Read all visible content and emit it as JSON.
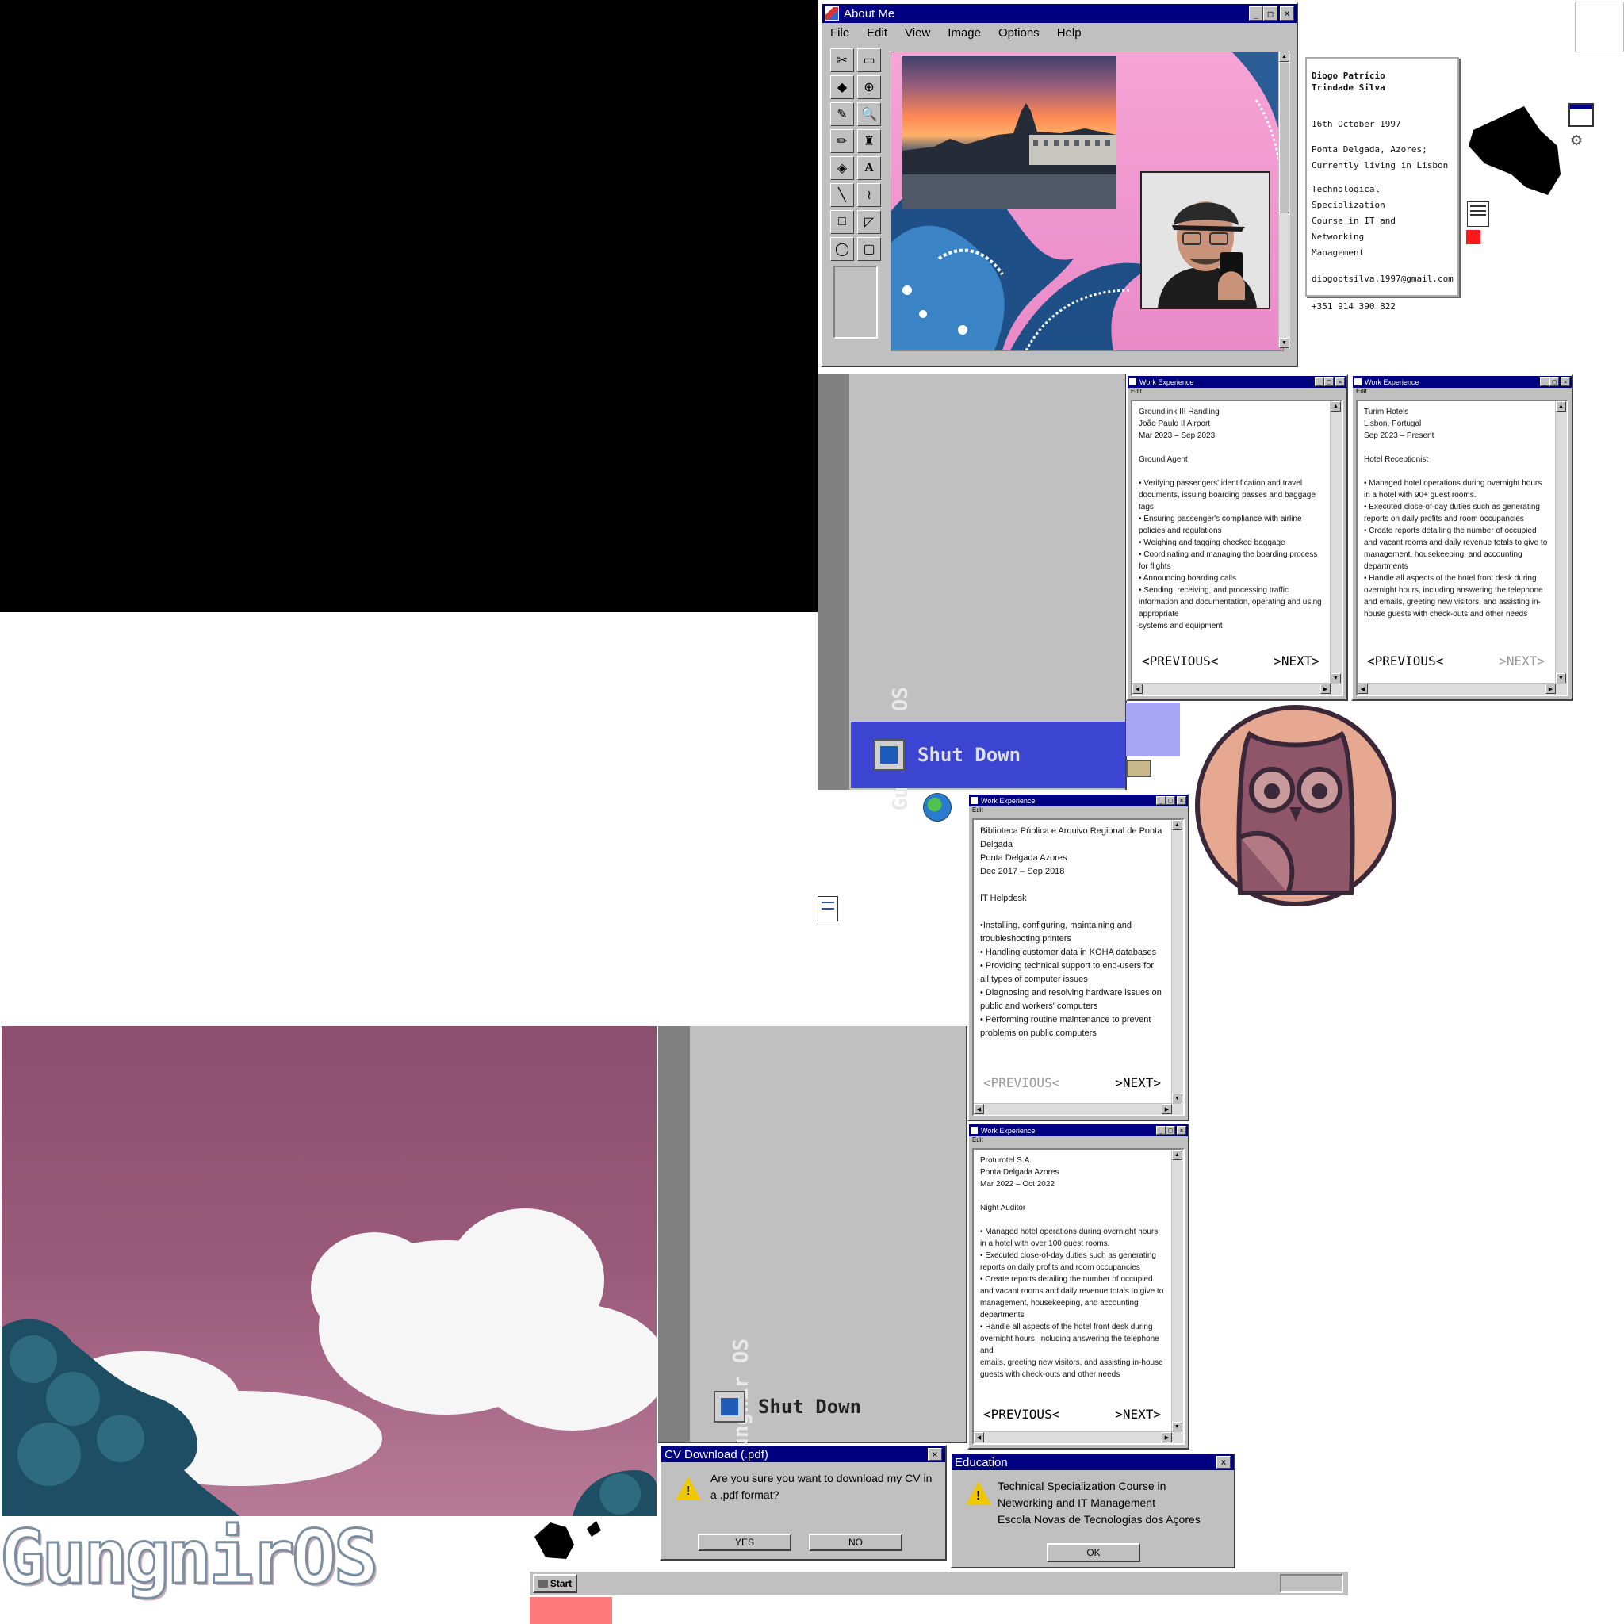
{
  "about": {
    "title": "About Me",
    "menu": [
      "File",
      "Edit",
      "View",
      "Image",
      "Options",
      "Help"
    ],
    "tools": [
      "✂",
      "▭",
      "◆",
      "⊕",
      "✎",
      "🔍",
      "✏",
      "♜",
      "◈",
      "A",
      "╲",
      "≀",
      "□",
      "◸",
      "◯",
      "▢"
    ]
  },
  "id_card": {
    "name": "Diogo Patrício\nTrindade Silva",
    "birth": "16th October 1997",
    "location": "Ponta Delgada, Azores;\nCurrently living in Lisbon",
    "education": "Technological Specialization\nCourse in IT and Networking\nManagement",
    "email": "diogoptsilva.1997@gmail.com",
    "phone": "+351 914 390 822"
  },
  "start_menu": {
    "brand": "Gungnir OS",
    "shutdown": "Shut Down"
  },
  "work_windows": [
    {
      "title": "Work Experience",
      "menu": "Edit",
      "text": "Groundlink III Handling\nJoão Paulo II Airport\nMar 2023 – Sep 2023\n\nGround Agent\n\n• Verifying passengers' identification and travel documents, issuing boarding passes and baggage tags\n• Ensuring passenger's compliance with airline policies and regulations\n• Weighing and tagging checked baggage\n• Coordinating and managing the boarding process for flights\n• Announcing boarding calls\n• Sending, receiving, and processing traffic information and documentation, operating and using appropriate\nsystems and equipment",
      "prev": "<PREVIOUS<",
      "next": ">NEXT>"
    },
    {
      "title": "Work Experience",
      "menu": "Edit",
      "text": "Turim Hotels\nLisbon, Portugal\nSep 2023 – Present\n\nHotel Receptionist\n\n• Managed hotel operations during overnight hours in a hotel with 90+ guest rooms.\n• Executed close-of-day duties such as generating reports on daily profits and room occupancies\n• Create reports detailing the number of occupied and vacant rooms and daily revenue totals to give to management, housekeeping, and accounting departments\n• Handle all aspects of the hotel front desk during overnight hours, including answering the telephone and emails, greeting new visitors, and assisting in-house guests with check-outs and other needs",
      "prev": "<PREVIOUS<",
      "next": ">NEXT>"
    },
    {
      "title": "Work Experience",
      "menu": "Edit",
      "text": "Biblioteca Pública e Arquivo Regional de Ponta Delgada\nPonta Delgada Azores\nDec 2017 – Sep 2018\n\nIT Helpdesk\n\n•Installing, configuring, maintaining and troubleshooting printers\n• Handling customer data in KOHA databases\n• Providing technical support to end-users for all types of computer issues\n• Diagnosing and resolving hardware issues on public and workers' computers\n• Performing routine maintenance to prevent problems on public computers",
      "prev": "<PREVIOUS<",
      "next": ">NEXT>"
    },
    {
      "title": "Work Experience",
      "menu": "Edit",
      "text": "Proturotel S.A.\nPonta Delgada Azores\nMar 2022 – Oct 2022\n\nNight Auditor\n\n• Managed hotel operations during overnight hours in a hotel with over 100 guest rooms.\n• Executed close-of-day duties such as generating reports on daily profits and room occupancies\n• Create reports detailing the number of occupied and vacant rooms and daily revenue totals to give to\nmanagement, housekeeping, and accounting departments\n• Handle all aspects of the hotel front desk during overnight hours, including answering the telephone and\nemails, greeting new visitors, and assisting in-house guests with check-outs and other needs",
      "prev": "<PREVIOUS<",
      "next": ">NEXT>"
    }
  ],
  "cv_dialog": {
    "title": "CV Download (.pdf)",
    "message": "Are you sure you want to download my CV in a .pdf format?",
    "yes": "YES",
    "no": "NO"
  },
  "education_dialog": {
    "title": "Education",
    "message": "Technical Specialization Course in\nNetworking and IT Management\nEscola Novas de Tecnologias dos Açores",
    "ok": "OK"
  },
  "taskbar": {
    "start": "Start"
  },
  "logo": "GungnirOS",
  "colors": {
    "titlebar": "#000080",
    "window": "#c0c0c0",
    "startmenu_blue": "#3b45d1",
    "sky": "#9a5a7a",
    "owl_bg": "#e6a891"
  }
}
